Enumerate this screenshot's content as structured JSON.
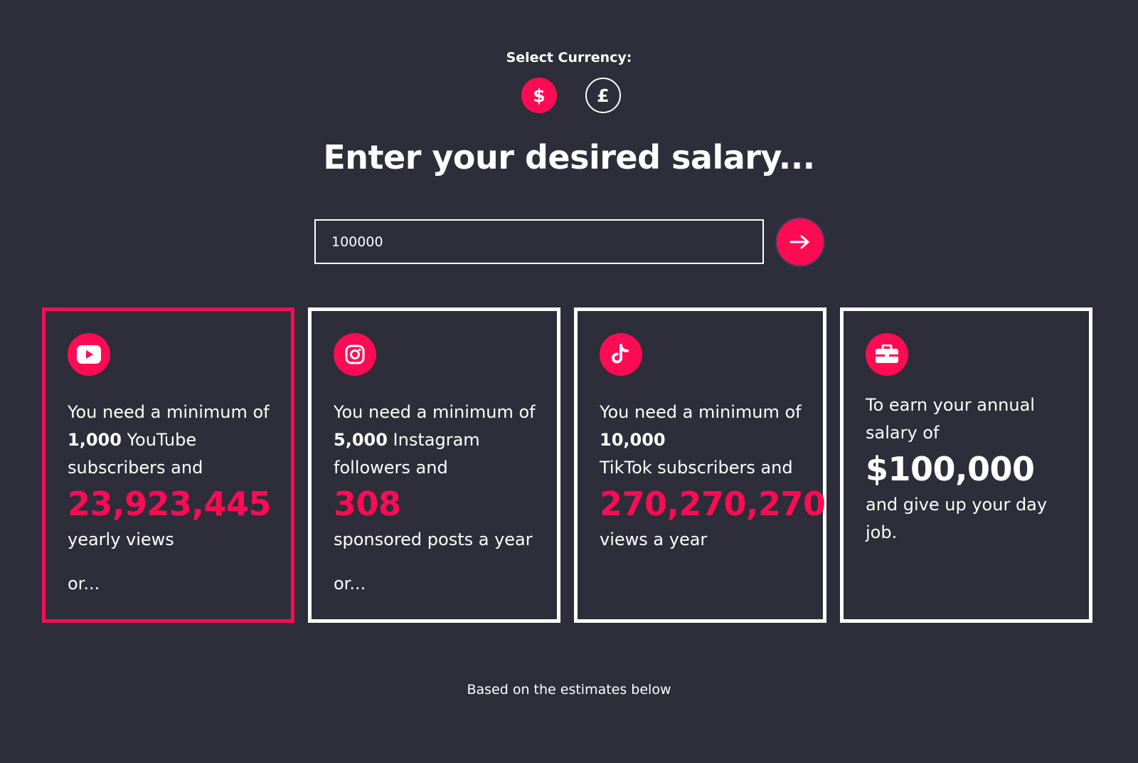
{
  "colors": {
    "background": "#2e2d3a",
    "accent": "#fe0c53",
    "text": "#ffffff"
  },
  "currency": {
    "label": "Select Currency:",
    "options": [
      {
        "symbol": "$",
        "selected": true
      },
      {
        "symbol": "£",
        "selected": false
      }
    ]
  },
  "headline": "Enter your desired salary...",
  "salary_input": {
    "value": "100000"
  },
  "submit_icon": "arrow-right-icon",
  "cards": [
    {
      "icon": "youtube-icon",
      "line1": "You need a minimum of",
      "bold": "1,000",
      "line2": " YouTube",
      "line3": "subscribers and",
      "big": "23,923,445",
      "after": "yearly views",
      "or": "or..."
    },
    {
      "icon": "instagram-icon",
      "line1": "You need a minimum of",
      "bold": "5,000",
      "line2": " Instagram",
      "line3": "followers and",
      "big": "308",
      "after": "sponsored posts a year",
      "or": "or..."
    },
    {
      "icon": "tiktok-icon",
      "line1": "You need a minimum of",
      "bold": "10,000",
      "line2": "",
      "line3": "TikTok subscribers and",
      "big": "270,270,270",
      "after": "views a year",
      "or": ""
    },
    {
      "icon": "briefcase-icon",
      "line1": "To earn your annual salary of",
      "big": "$100,000",
      "after": "and give up your day job."
    }
  ],
  "footer_note": "Based on the estimates below"
}
